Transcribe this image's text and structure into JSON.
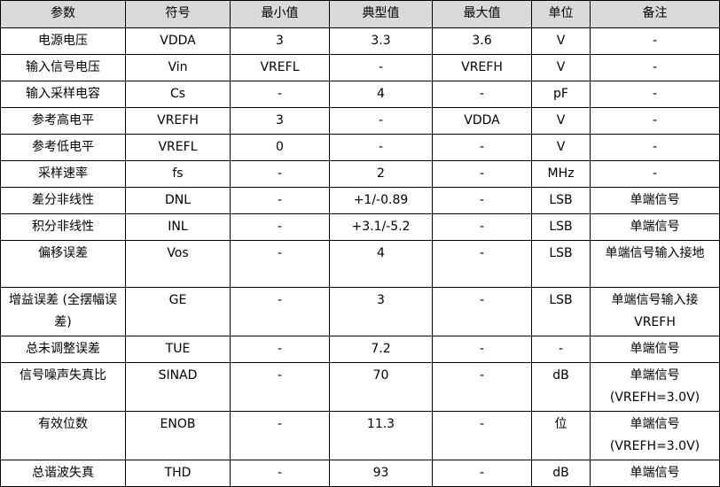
{
  "headers": [
    "参数",
    "符号",
    "最小值",
    "典型值",
    "最大值",
    "单位",
    "备注"
  ],
  "rows": [
    {
      "param": "电源电压",
      "symbol": "VDDA",
      "min": "3",
      "typ": "3.3",
      "max": "3.6",
      "unit": "V",
      "note": "-"
    },
    {
      "param": "输入信号电压",
      "symbol": "Vin",
      "min": "VREFL",
      "typ": "-",
      "max": "VREFH",
      "unit": "V",
      "note": "-"
    },
    {
      "param": "输入采样电容",
      "symbol": "Cs",
      "min": "-",
      "typ": "4",
      "max": "-",
      "unit": "pF",
      "note": "-"
    },
    {
      "param": "参考高电平",
      "symbol": "VREFH",
      "min": "3",
      "typ": "-",
      "max": "VDDA",
      "unit": "V",
      "note": "-"
    },
    {
      "param": "参考低电平",
      "symbol": "VREFL",
      "min": "0",
      "typ": "-",
      "max": "-",
      "unit": "V",
      "note": "-"
    },
    {
      "param": "采样速率",
      "symbol": "fs",
      "min": "-",
      "typ": "2",
      "max": "-",
      "unit": "MHz",
      "note": "-"
    },
    {
      "param": "差分非线性",
      "symbol": "DNL",
      "min": "-",
      "typ": "+1/-0.89",
      "max": "-",
      "unit": "LSB",
      "note": "单端信号"
    },
    {
      "param": "积分非线性",
      "symbol": "INL",
      "min": "-",
      "typ": "+3.1/-5.2",
      "max": "-",
      "unit": "LSB",
      "note": "单端信号"
    },
    {
      "param": "偏移误差",
      "symbol": "Vos",
      "min": "-",
      "typ": "4",
      "max": "-",
      "unit": "LSB",
      "note": "单端信号输入接地"
    },
    {
      "param": "增益误差 (全摆幅误差)",
      "symbol": "GE",
      "min": "-",
      "typ": "3",
      "max": "-",
      "unit": "LSB",
      "note": "单端信号输入接VREFH"
    },
    {
      "param": "总未调整误差",
      "symbol": "TUE",
      "min": "-",
      "typ": "7.2",
      "max": "-",
      "unit": "-",
      "note": "单端信号"
    },
    {
      "param": "信号噪声失真比",
      "symbol": "SINAD",
      "min": "-",
      "typ": "70",
      "max": "-",
      "unit": "dB",
      "note": "单端信号 (VREFH=3.0V)"
    },
    {
      "param": "有效位数",
      "symbol": "ENOB",
      "min": "-",
      "typ": "11.3",
      "max": "-",
      "unit": "位",
      "note": "单端信号 (VREFH=3.0V)"
    },
    {
      "param": "总谐波失真",
      "symbol": "THD",
      "min": "-",
      "typ": "93",
      "max": "-",
      "unit": "dB",
      "note": "单端信号"
    }
  ]
}
